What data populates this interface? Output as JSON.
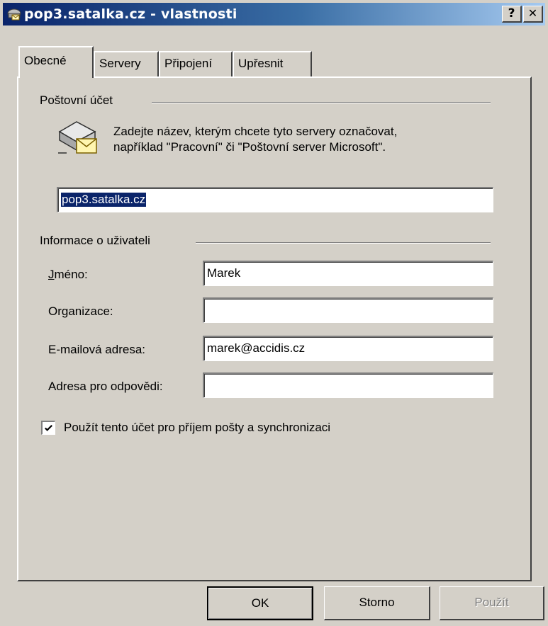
{
  "window": {
    "title": "pop3.satalka.cz - vlastnosti",
    "help_button": "?",
    "close_button": "✕"
  },
  "tabs": [
    {
      "label": "Obecné",
      "active": true
    },
    {
      "label": "Servery",
      "active": false
    },
    {
      "label": "Připojení",
      "active": false
    },
    {
      "label": "Upřesnit",
      "active": false
    }
  ],
  "mail_account": {
    "group_label": "Poštovní účet",
    "description_line1": "Zadejte název, kterým chcete tyto servery označovat,",
    "description_line2": "například \"Pracovní\" či \"Poštovní server Microsoft\".",
    "account_name": "pop3.satalka.cz",
    "icon": "mail-server-icon"
  },
  "user_info": {
    "group_label": "Informace o uživateli",
    "name_label": "Jméno:",
    "name_value": "Marek",
    "org_label": "Organizace:",
    "org_value": "",
    "email_label": "E-mailová adresa:",
    "email_value": "marek@accidis.cz",
    "reply_label": "Adresa pro odpovědi:",
    "reply_value": ""
  },
  "checkbox": {
    "label": "Použít tento účet pro příjem pošty a synchronizaci",
    "checked": true
  },
  "buttons": {
    "ok": "OK",
    "cancel": "Storno",
    "apply": "Použít",
    "apply_enabled": false
  },
  "colors": {
    "title_active_start": "#0a246a",
    "title_active_end": "#a6caf0",
    "face": "#d4d0c8",
    "selection": "#0a246a"
  }
}
